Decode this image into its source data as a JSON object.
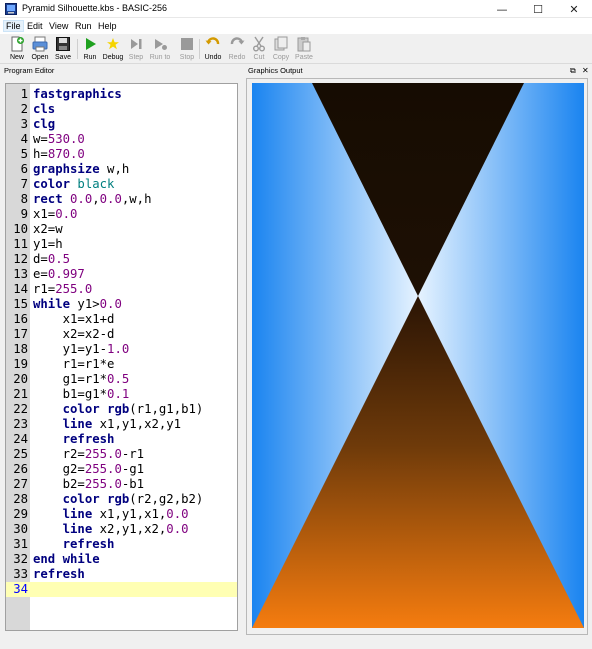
{
  "window": {
    "title": "Pyramid Silhouette.kbs - BASIC-256",
    "minimize": "—",
    "maximize": "☐",
    "close": "✕"
  },
  "menu": [
    "File",
    "Edit",
    "View",
    "Run",
    "Help"
  ],
  "toolbar": {
    "new": "New",
    "open": "Open",
    "save": "Save",
    "run": "Run",
    "debug": "Debug",
    "step": "Step",
    "run_to": "Run to",
    "stop": "Stop",
    "undo": "Undo",
    "redo": "Redo",
    "cut": "Cut",
    "copy": "Copy",
    "paste": "Paste"
  },
  "panels": {
    "editor_title": "Program Editor",
    "graphics_title": "Graphics Output",
    "float_glyph": "⧉",
    "close_glyph": "✕"
  },
  "code": [
    "1",
    "2",
    "3",
    "4",
    "5",
    "6",
    "7",
    "8",
    "9",
    "10",
    "11",
    "12",
    "13",
    "14",
    "15",
    "16",
    "17",
    "18",
    "19",
    "20",
    "21",
    "22",
    "23",
    "24",
    "25",
    "26",
    "27",
    "28",
    "29",
    "30",
    "31",
    "32",
    "33",
    "34"
  ],
  "program": {
    "l1": "fastgraphics",
    "l2": "cls",
    "l3": "clg",
    "l4a": "w=",
    "l4b": "530.0",
    "l5a": "h=",
    "l5b": "870.0",
    "l6a": "graphsize",
    "l6b": " w,h",
    "l7a": "color",
    "l7b": " black",
    "l8a": "rect",
    "l8b": " 0.0",
    "l8c": ",",
    "l8d": "0.0",
    "l8e": ",w,h",
    "l9a": "x1=",
    "l9b": "0.0",
    "l10": "x2=w",
    "l11": "y1=h",
    "l12a": "d=",
    "l12b": "0.5",
    "l13a": "e=",
    "l13b": "0.997",
    "l14a": "r1=",
    "l14b": "255.0",
    "l15a": "while",
    "l15b": " y1>",
    "l15c": "0.0",
    "l16": "    x1=x1+d",
    "l17": "    x2=x2-d",
    "l18a": "    y1=y1-",
    "l18b": "1.0",
    "l19": "    r1=r1*e",
    "l20a": "    g1=r1*",
    "l20b": "0.5",
    "l21a": "    b1=g1*",
    "l21b": "0.1",
    "l22a": "    ",
    "l22b": "color",
    "l22c": " ",
    "l22d": "rgb",
    "l22e": "(r1,g1,b1)",
    "l23a": "    ",
    "l23b": "line",
    "l23c": " x1,y1,x2,y1",
    "l24a": "    ",
    "l24b": "refresh",
    "l25a": "    r2=",
    "l25b": "255.0",
    "l25c": "-r1",
    "l26a": "    g2=",
    "l26b": "255.0",
    "l26c": "-g1",
    "l27a": "    b2=",
    "l27b": "255.0",
    "l27c": "-b1",
    "l28a": "    ",
    "l28b": "color",
    "l28c": " ",
    "l28d": "rgb",
    "l28e": "(r2,g2,b2)",
    "l29a": "    ",
    "l29b": "line",
    "l29c": " x1,y1,x1,",
    "l29d": "0.0",
    "l30a": "    ",
    "l30b": "line",
    "l30c": " x2,y1,x2,",
    "l30d": "0.0",
    "l31a": "    ",
    "l31b": "refresh",
    "l32": "end while",
    "l33": "refresh"
  },
  "colors": {
    "keyword": "#00007f",
    "number": "#7f007f",
    "color_const": "#007f7f",
    "current_line": "#ffffb3",
    "sky_edge": "#1a84f0",
    "sky_center": "#e6f3ff",
    "top_triangle": "#1a0e02",
    "bottom_triangle_top": "#3a1d05",
    "bottom_triangle_bottom": "#f57c0f"
  }
}
